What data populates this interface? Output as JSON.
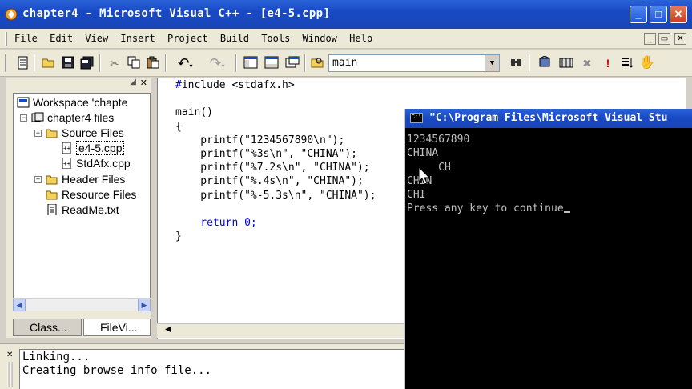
{
  "window": {
    "title": "chapter4 - Microsoft Visual C++ - [e4-5.cpp]",
    "minimize_glyph": "_",
    "maximize_glyph": "□",
    "close_glyph": "✕"
  },
  "menubar": {
    "items": [
      "File",
      "Edit",
      "View",
      "Insert",
      "Project",
      "Build",
      "Tools",
      "Window",
      "Help"
    ],
    "mdi_min": "_",
    "mdi_restore": "▭",
    "mdi_close": "✕"
  },
  "toolbar": {
    "combo_value": "main",
    "icons": [
      "workspace-icon",
      "open-icon",
      "save-icon",
      "save-all-icon",
      "cut-icon",
      "copy-icon",
      "paste-icon",
      "undo-icon",
      "redo-icon",
      "workspace-window-icon",
      "output-window-icon",
      "window-list-icon",
      "find-in-files-icon",
      "find-icon",
      "compile-icon",
      "build-icon",
      "stop-build-icon",
      "execute-icon",
      "go-icon",
      "breakpoint-icon"
    ]
  },
  "workspace": {
    "tree": [
      {
        "label": "Workspace 'chapte",
        "icon": "workspace-icon"
      },
      {
        "label": "chapter4 files",
        "icon": "project-icon"
      },
      {
        "label": "Source Files",
        "icon": "folder-open-icon"
      },
      {
        "label": "e4-5.cpp",
        "icon": "cpp-file-icon"
      },
      {
        "label": "StdAfx.cpp",
        "icon": "cpp-file-icon"
      },
      {
        "label": "Header Files",
        "icon": "folder-icon"
      },
      {
        "label": "Resource Files",
        "icon": "folder-icon"
      },
      {
        "label": "ReadMe.txt",
        "icon": "text-file-icon"
      }
    ],
    "tabs": [
      "Class...",
      "FileVi..."
    ]
  },
  "editor": {
    "code_lines": [
      "#include <stdafx.h>",
      "",
      "main()",
      "{",
      "    printf(\"1234567890\\n\");",
      "    printf(\"%3s\\n\", \"CHINA\");",
      "    printf(\"%7.2s\\n\", \"CHINA\");",
      "    printf(\"%.4s\\n\", \"CHINA\");",
      "    printf(\"%-5.3s\\n\", \"CHINA\");",
      "",
      "    return 0;",
      "}"
    ]
  },
  "output": {
    "lines": [
      "Linking...",
      "Creating browse info file..."
    ]
  },
  "console": {
    "icon_text": "C:\\",
    "title": "\"C:\\Program Files\\Microsoft Visual Stu",
    "lines": [
      "1234567890",
      "CHINA",
      "     CH",
      "CHIN",
      "CHI",
      "Press any key to continue"
    ]
  },
  "colors": {
    "titlebar": "#1849c4",
    "console_bg": "#000000",
    "console_text": "#c0c0c0",
    "keyword": "#0000ff"
  }
}
